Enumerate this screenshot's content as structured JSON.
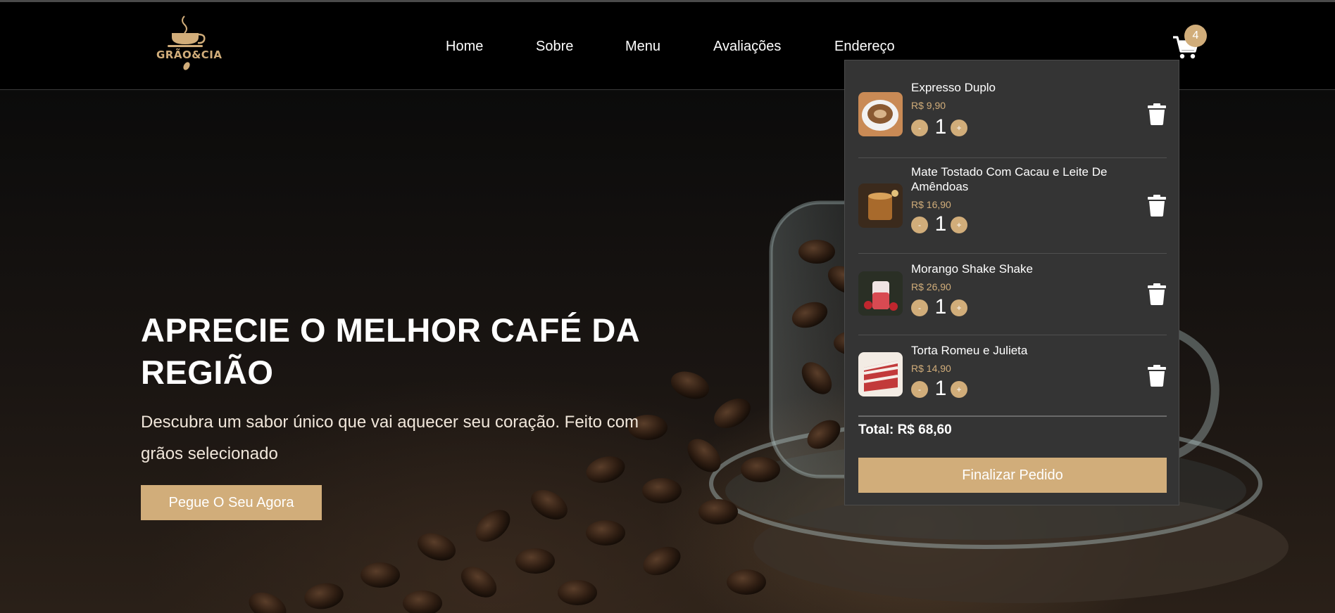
{
  "brand": {
    "logo_text": "GRÃO&CIA"
  },
  "nav": {
    "items": [
      "Home",
      "Sobre",
      "Menu",
      "Avaliações",
      "Endereço"
    ]
  },
  "cart": {
    "badge_count": "4",
    "items": [
      {
        "name": "Expresso Duplo",
        "price": "R$ 9,90",
        "qty": "1",
        "image": "espresso-cup"
      },
      {
        "name": "Mate Tostado Com Cacau e Leite De Amêndoas",
        "price": "R$ 16,90",
        "qty": "1",
        "image": "mate-tea"
      },
      {
        "name": "Morango Shake Shake",
        "price": "R$ 26,90",
        "qty": "1",
        "image": "strawberry-shake"
      },
      {
        "name": "Torta Romeu e Julieta",
        "price": "R$ 14,90",
        "qty": "1",
        "image": "red-velvet-cake"
      }
    ],
    "minus_label": "-",
    "plus_label": "+",
    "total": "Total: R$ 68,60",
    "checkout_label": "Finalizar Pedido"
  },
  "hero": {
    "title": "APRECIE O MELHOR CAFÉ DA REGIÃO",
    "subtitle": "Descubra um sabor único que vai aquecer seu coração. Feito com grãos selecionado",
    "cta_label": "Pegue O Seu Agora"
  },
  "colors": {
    "accent": "#d1ad7a",
    "panel": "#343434",
    "header_bg": "#000000"
  }
}
